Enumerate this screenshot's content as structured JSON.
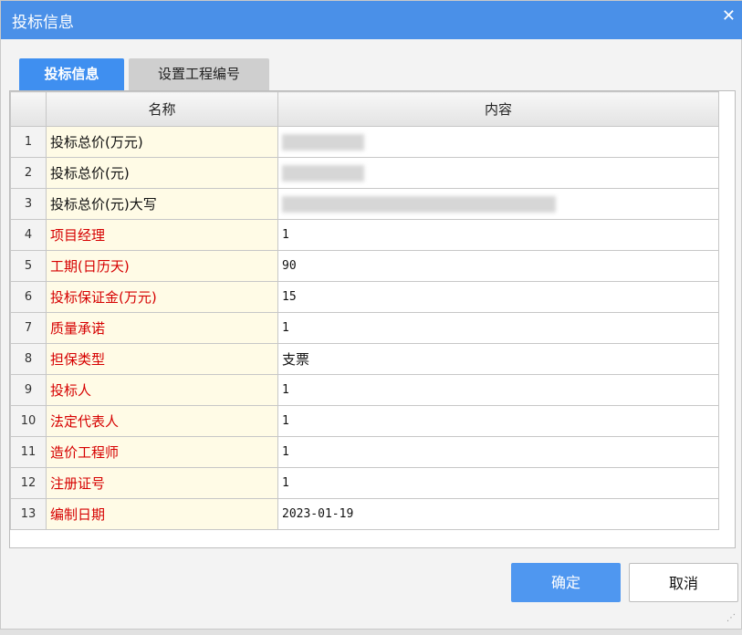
{
  "window": {
    "title": "投标信息",
    "close_glyph": "✕"
  },
  "tabs": [
    {
      "label": "投标信息",
      "active": true
    },
    {
      "label": "设置工程编号",
      "active": false
    }
  ],
  "table": {
    "headers": [
      "",
      "名称",
      "内容"
    ],
    "rows": [
      {
        "num": "1",
        "name": "投标总价(万元)",
        "value": "",
        "required": false,
        "redacted": true
      },
      {
        "num": "2",
        "name": "投标总价(元)",
        "value": "",
        "required": false,
        "redacted": true
      },
      {
        "num": "3",
        "name": "投标总价(元)大写",
        "value": "",
        "required": false,
        "redacted": true
      },
      {
        "num": "4",
        "name": "项目经理",
        "value": "1",
        "required": true
      },
      {
        "num": "5",
        "name": "工期(日历天)",
        "value": "90",
        "required": true
      },
      {
        "num": "6",
        "name": "投标保证金(万元)",
        "value": "15",
        "required": true
      },
      {
        "num": "7",
        "name": "质量承诺",
        "value": "1",
        "required": true
      },
      {
        "num": "8",
        "name": "担保类型",
        "value": "支票",
        "required": true
      },
      {
        "num": "9",
        "name": "投标人",
        "value": "1",
        "required": true
      },
      {
        "num": "10",
        "name": "法定代表人",
        "value": "1",
        "required": true
      },
      {
        "num": "11",
        "name": "造价工程师",
        "value": "1",
        "required": true
      },
      {
        "num": "12",
        "name": "注册证号",
        "value": "1",
        "required": true
      },
      {
        "num": "13",
        "name": "编制日期",
        "value": "2023-01-19",
        "required": true
      }
    ]
  },
  "buttons": {
    "ok": "确定",
    "cancel": "取消"
  },
  "colors": {
    "titlebar": "#4a90e8",
    "accent": "#3f8ff0",
    "required_text": "#d60000",
    "name_cell_bg": "#fffbe6"
  }
}
